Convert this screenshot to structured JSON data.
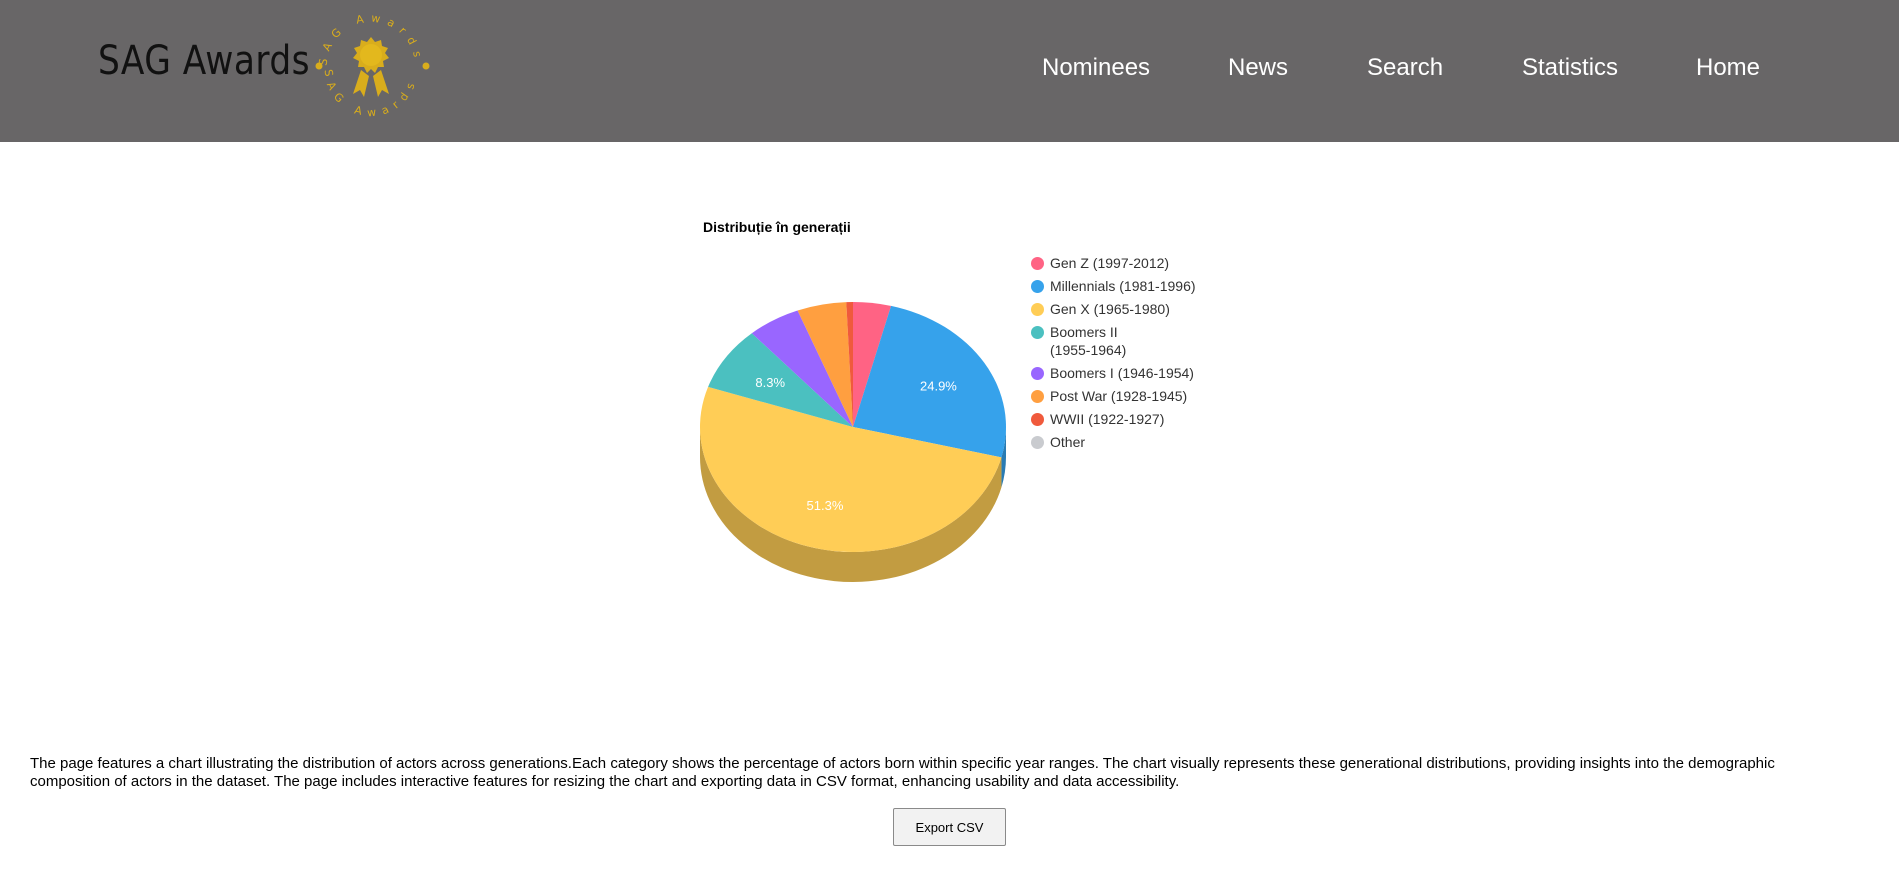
{
  "header": {
    "brand": "SAG Awards",
    "logo_ring_text": "SAG Awards",
    "nav": [
      {
        "label": "Nominees"
      },
      {
        "label": "News"
      },
      {
        "label": "Search"
      },
      {
        "label": "Statistics"
      },
      {
        "label": "Home"
      }
    ]
  },
  "colors": {
    "header_bg": "#686667",
    "logo_gold": "#d9ad1c"
  },
  "chart_data": {
    "type": "pie",
    "title": "Distribuție în generații",
    "three_d": true,
    "legend_position": "right",
    "categories": [
      "Gen Z (1997-2012)",
      "Millennials (1981-1996)",
      "Gen X (1965-1980)",
      "Boomers II (1955-1964)",
      "Boomers I (1946-1954)",
      "Post War (1928-1945)",
      "WWII (1922-1927)",
      "Other"
    ],
    "values": [
      4.0,
      24.9,
      51.3,
      8.3,
      5.6,
      5.2,
      0.7,
      0.0
    ],
    "data_labels": [
      "",
      "24.9%",
      "51.3%",
      "8.3%",
      "",
      "",
      "",
      ""
    ],
    "colors": [
      "#ff6384",
      "#36a2eb",
      "#ffcd56",
      "#4bc0c0",
      "#9966ff",
      "#ff9f40",
      "#f05a3c",
      "#c9cbcf"
    ],
    "legend_display": [
      [
        "Gen Z (1997-2012)"
      ],
      [
        "Millennials (1981-1996)"
      ],
      [
        "Gen X (1965-1980)"
      ],
      [
        "Boomers II",
        "(1955-1964)"
      ],
      [
        "Boomers I (1946-1954)"
      ],
      [
        "Post War (1928-1945)"
      ],
      [
        "WWII (1922-1927)"
      ],
      [
        "Other"
      ]
    ]
  },
  "description": "The page features a chart illustrating the distribution of actors across generations.Each category shows the percentage of actors born within specific year ranges. The chart visually represents these generational distributions, providing insights into the demographic composition of actors in the dataset. The page includes interactive features for resizing the chart and exporting data in CSV format, enhancing usability and data accessibility.",
  "export_button": "Export CSV"
}
